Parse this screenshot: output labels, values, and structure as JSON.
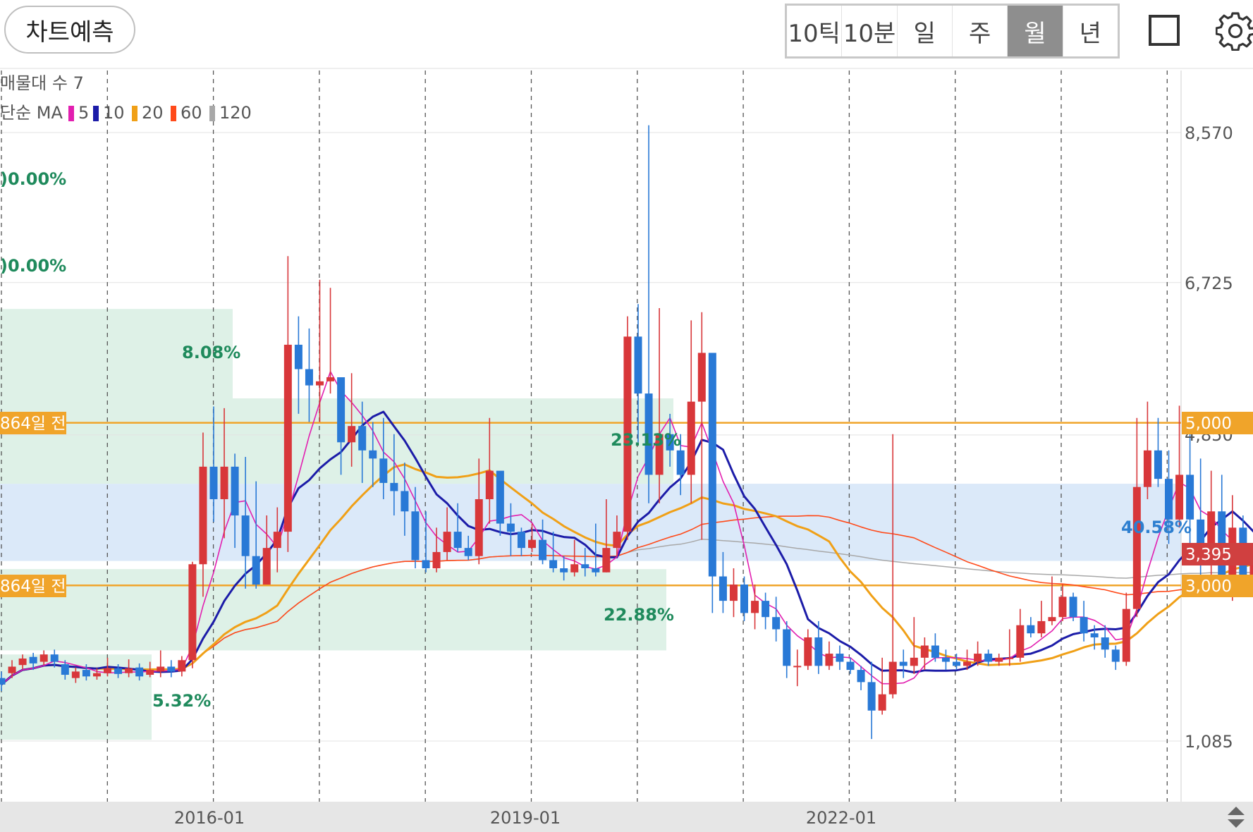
{
  "header": {
    "predict_button": "차트예측",
    "periods": [
      "10틱",
      "10분",
      "일",
      "주",
      "월",
      "년"
    ],
    "active_period": "월"
  },
  "indicators": {
    "volume_profile_label": "매물대 수 7",
    "ma_prefix": "단순 MA",
    "ma": [
      {
        "period": "5",
        "color": "#e21fb0"
      },
      {
        "period": "10",
        "color": "#1c1ca8"
      },
      {
        "period": "20",
        "color": "#f0a017"
      },
      {
        "period": "60",
        "color": "#ff4a1a"
      },
      {
        "period": "120",
        "color": "#a8a8a8"
      }
    ]
  },
  "colors": {
    "up": "#d8373a",
    "down": "#2979d6",
    "zone_green": "#def1e7",
    "zone_blue": "#dbe9f9",
    "level_line": "#f0a42a"
  },
  "chart_data": {
    "type": "candlestick",
    "period": "monthly",
    "y_ticks": [
      "8,570",
      "6,725",
      "4,850",
      "1,085"
    ],
    "y_tick_values": [
      8570,
      6725,
      4850,
      1085
    ],
    "x_ticks": [
      "2016-01",
      "2019-01",
      "2022-01"
    ],
    "current_price": "3,395",
    "volume_profile_zones": [
      {
        "low": 3300,
        "high": 4250,
        "pct": "",
        "kind": "blue"
      },
      {
        "low": 4250,
        "high": 5300,
        "pct": "23.13%",
        "kind": "green"
      },
      {
        "low": 2200,
        "high": 3200,
        "pct": "22.88%",
        "kind": "green"
      },
      {
        "low": 5300,
        "high": 6400,
        "pct": "8.08%",
        "kind": "green"
      },
      {
        "low": 1100,
        "high": 2150,
        "pct": "5.32%",
        "kind": "green"
      }
    ],
    "clipped_percent_labels": [
      ")0.00%",
      ")0.00%"
    ],
    "extra_percent_label": "40.58%",
    "horizontal_levels": [
      {
        "price": 5000,
        "left_label": "864일 전",
        "right_label": "5,000"
      },
      {
        "price": 3000,
        "left_label": "864일 전",
        "right_label": "3,000"
      }
    ],
    "candles": [
      [
        1860,
        1780,
        1940,
        1700
      ],
      [
        1920,
        2000,
        2080,
        1860
      ],
      [
        2020,
        2100,
        2150,
        1970
      ],
      [
        2120,
        2040,
        2170,
        1960
      ],
      [
        2060,
        2150,
        2200,
        2020
      ],
      [
        2150,
        2060,
        2210,
        1990
      ],
      [
        2030,
        1900,
        2080,
        1840
      ],
      [
        1860,
        1940,
        1990,
        1800
      ],
      [
        1960,
        1880,
        2030,
        1830
      ],
      [
        1880,
        1920,
        1980,
        1840
      ],
      [
        1920,
        1980,
        2110,
        1880
      ],
      [
        1980,
        1910,
        2030,
        1860
      ],
      [
        1920,
        1980,
        2090,
        1870
      ],
      [
        1990,
        1880,
        2040,
        1830
      ],
      [
        1900,
        1960,
        2060,
        1870
      ],
      [
        1940,
        2000,
        2200,
        1870
      ],
      [
        2000,
        1940,
        2080,
        1870
      ],
      [
        1940,
        2080,
        2130,
        1880
      ],
      [
        2080,
        3260,
        3290,
        1980
      ],
      [
        3260,
        4460,
        4880,
        2860
      ],
      [
        4460,
        4060,
        5200,
        3780
      ],
      [
        4060,
        4460,
        5180,
        3580
      ],
      [
        4460,
        3860,
        4620,
        3460
      ],
      [
        3860,
        3360,
        4580,
        2960
      ],
      [
        3360,
        3010,
        4280,
        2960
      ],
      [
        3010,
        3460,
        3860,
        3060
      ],
      [
        3460,
        3660,
        3960,
        3160
      ],
      [
        3660,
        5960,
        7050,
        3410
      ],
      [
        5960,
        5660,
        6310,
        5110
      ],
      [
        5660,
        5460,
        6160,
        5010
      ],
      [
        5460,
        5510,
        6760,
        5010
      ],
      [
        5510,
        5560,
        6660,
        5360
      ],
      [
        5560,
        4760,
        5260,
        4360
      ],
      [
        4760,
        4960,
        5610,
        4460
      ],
      [
        4960,
        4660,
        5260,
        4260
      ],
      [
        4660,
        4560,
        5010,
        4210
      ],
      [
        4560,
        4260,
        5060,
        4060
      ],
      [
        4260,
        4160,
        4860,
        3860
      ],
      [
        4160,
        3910,
        4510,
        3610
      ],
      [
        3910,
        3310,
        4210,
        3210
      ],
      [
        3310,
        3210,
        3910,
        3160
      ],
      [
        3210,
        3410,
        3710,
        3160
      ],
      [
        3410,
        3660,
        3960,
        3310
      ],
      [
        3660,
        3460,
        4010,
        3410
      ],
      [
        3460,
        3360,
        3610,
        3310
      ],
      [
        3360,
        4060,
        4560,
        3260
      ],
      [
        4060,
        4410,
        5060,
        3760
      ],
      [
        4410,
        3760,
        4160,
        3610
      ],
      [
        3760,
        3660,
        4010,
        3360
      ],
      [
        3660,
        3460,
        3710,
        3360
      ],
      [
        3460,
        3560,
        3760,
        3410
      ],
      [
        3560,
        3310,
        3810,
        3260
      ],
      [
        3310,
        3210,
        3660,
        3160
      ],
      [
        3210,
        3160,
        3360,
        3060
      ],
      [
        3160,
        3260,
        3560,
        3110
      ],
      [
        3260,
        3210,
        3460,
        3110
      ],
      [
        3210,
        3160,
        3760,
        3110
      ],
      [
        3160,
        3460,
        4060,
        3160
      ],
      [
        3460,
        3660,
        3860,
        3360
      ],
      [
        3660,
        6060,
        6310,
        3560
      ],
      [
        6060,
        5360,
        6460,
        4760
      ],
      [
        5360,
        4360,
        8660,
        4010
      ],
      [
        4360,
        4860,
        6410,
        4010
      ],
      [
        4860,
        4660,
        5110,
        4460
      ],
      [
        4660,
        4360,
        4860,
        4110
      ],
      [
        4360,
        5260,
        6260,
        4010
      ],
      [
        5260,
        5860,
        6360,
        3560
      ],
      [
        5860,
        3110,
        4460,
        2660
      ],
      [
        3110,
        2810,
        3410,
        2660
      ],
      [
        2810,
        3010,
        3210,
        2610
      ],
      [
        3010,
        2660,
        3110,
        2560
      ],
      [
        2660,
        2810,
        3010,
        2460
      ],
      [
        2810,
        2610,
        2910,
        2460
      ],
      [
        2610,
        2460,
        2860,
        2310
      ],
      [
        2460,
        2010,
        2560,
        1860
      ],
      [
        2010,
        2010,
        2210,
        1760
      ],
      [
        2010,
        2360,
        2460,
        1960
      ],
      [
        2360,
        2010,
        2560,
        1910
      ],
      [
        2010,
        2160,
        2310,
        1960
      ],
      [
        2160,
        2060,
        2260,
        1960
      ],
      [
        2060,
        1960,
        2110,
        1910
      ],
      [
        1960,
        1810,
        2010,
        1710
      ],
      [
        1810,
        1460,
        2060,
        1110
      ],
      [
        1460,
        1660,
        2110,
        1410
      ],
      [
        1660,
        2060,
        4860,
        1610
      ],
      [
        2060,
        2010,
        2210,
        1860
      ],
      [
        2010,
        2110,
        2610,
        1910
      ],
      [
        2110,
        2260,
        2360,
        1960
      ],
      [
        2260,
        2110,
        2410,
        2060
      ],
      [
        2110,
        2060,
        2210,
        1960
      ],
      [
        2060,
        2010,
        2160,
        1960
      ],
      [
        2010,
        2060,
        2210,
        1960
      ],
      [
        2060,
        2160,
        2310,
        2010
      ],
      [
        2160,
        2060,
        2210,
        2010
      ],
      [
        2060,
        2110,
        2160,
        2010
      ],
      [
        2110,
        2110,
        2460,
        2010
      ],
      [
        2110,
        2510,
        2710,
        2060
      ],
      [
        2510,
        2410,
        2610,
        2360
      ],
      [
        2410,
        2560,
        2810,
        2360
      ],
      [
        2560,
        2610,
        3110,
        2510
      ],
      [
        2610,
        2860,
        3010,
        2560
      ],
      [
        2860,
        2610,
        2910,
        2560
      ],
      [
        2610,
        2410,
        2810,
        2310
      ],
      [
        2410,
        2360,
        2510,
        2210
      ],
      [
        2360,
        2210,
        2510,
        2110
      ],
      [
        2210,
        2060,
        2260,
        1960
      ],
      [
        2060,
        2710,
        2910,
        2010
      ],
      [
        2710,
        4210,
        5060,
        2610
      ],
      [
        4210,
        4660,
        5260,
        4060
      ],
      [
        4660,
        4310,
        5060,
        4210
      ],
      [
        4310,
        3810,
        4660,
        3510
      ],
      [
        3810,
        4360,
        5210,
        3710
      ],
      [
        4360,
        3810,
        5060,
        3360
      ],
      [
        3810,
        3310,
        4560,
        3060
      ],
      [
        3310,
        3910,
        4410,
        3110
      ],
      [
        3910,
        3010,
        4360,
        2910
      ],
      [
        3010,
        3710,
        4110,
        2810
      ],
      [
        3710,
        3060,
        3860,
        2910
      ],
      [
        3060,
        3310,
        3510,
        2860
      ],
      [
        3310,
        3460,
        4010,
        3160
      ],
      [
        3460,
        3360,
        3860,
        3160
      ],
      [
        3360,
        3210,
        3860,
        3110
      ],
      [
        3210,
        3510,
        3760,
        3110
      ],
      [
        3510,
        4260,
        4760,
        3460
      ],
      [
        4260,
        4660,
        5410,
        4060
      ],
      [
        4660,
        4510,
        5160,
        4260
      ],
      [
        4510,
        3910,
        4310,
        3810
      ],
      [
        3910,
        3510,
        4010,
        3410
      ],
      [
        3510,
        3210,
        3760,
        3110
      ],
      [
        3210,
        3310,
        3460,
        3160
      ],
      [
        3310,
        3410,
        3610,
        3210
      ],
      [
        3410,
        3210,
        3510,
        3160
      ],
      [
        3210,
        3310,
        3460,
        3210
      ],
      [
        3310,
        3210,
        3660,
        3110
      ],
      [
        3210,
        3260,
        3410,
        3160
      ],
      [
        3260,
        3310,
        3410,
        3210
      ],
      [
        3310,
        3210,
        3510,
        3060
      ],
      [
        3210,
        3010,
        3310,
        2860
      ],
      [
        3010,
        2910,
        3110,
        2810
      ],
      [
        2910,
        3110,
        3310,
        2860
      ],
      [
        3110,
        3060,
        3760,
        2960
      ],
      [
        3060,
        3260,
        3460,
        3010
      ],
      [
        3260,
        3010,
        3210,
        2960
      ],
      [
        3010,
        3160,
        3310,
        2860
      ],
      [
        3160,
        3060,
        3210,
        3010
      ],
      [
        3060,
        3360,
        3560,
        3010
      ],
      [
        3360,
        3395,
        3510,
        3260
      ]
    ],
    "ma_series": {
      "ma5_start": [
        1860,
        1870,
        1900,
        1960,
        2000,
        2020,
        2000,
        1980,
        1960,
        1920
      ],
      "note_ma": []
    }
  }
}
